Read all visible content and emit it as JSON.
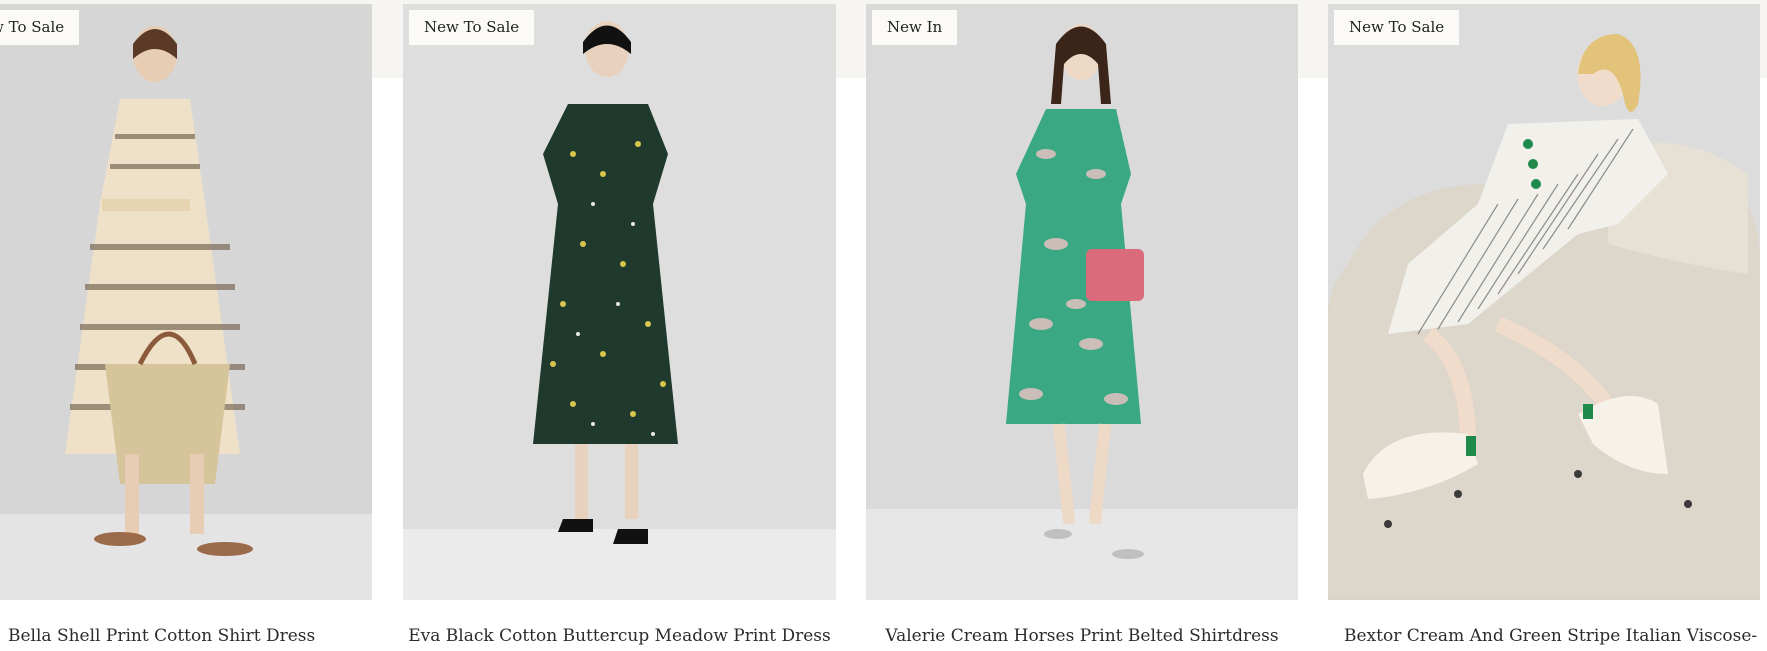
{
  "products": [
    {
      "badge": "New To Sale",
      "title": "Bella Shell Print Cotton Shirt Dress",
      "colors": {
        "bg": "#d7d7d7",
        "floor": "#e5e5e5",
        "garment": "#efe1c7",
        "pattern": "#7a6a58",
        "accent": "#c9ad7e"
      }
    },
    {
      "badge": "New To Sale",
      "title": "Eva Black Cotton Buttercup Meadow Print Dress",
      "colors": {
        "bg": "#dedede",
        "floor": "#ebebeb",
        "garment": "#1f3a2c",
        "pattern": "#d8c64c",
        "accent": "#111111"
      }
    },
    {
      "badge": "New In",
      "title": "Valerie Cream Horses Print Belted Shirtdress",
      "colors": {
        "bg": "#dadada",
        "floor": "#e7e7e7",
        "garment": "#3aa883",
        "pattern": "#e5c2c2",
        "accent": "#d96b7a"
      }
    },
    {
      "badge": "New To Sale",
      "title": "Bextor Cream And Green Stripe Italian Viscose-",
      "colors": {
        "bg": "#dcdcdc",
        "floor": "#e9e9e9",
        "garment": "#f1f0eb",
        "pattern": "#4a4a4a",
        "accent": "#1f8a4a"
      }
    }
  ]
}
